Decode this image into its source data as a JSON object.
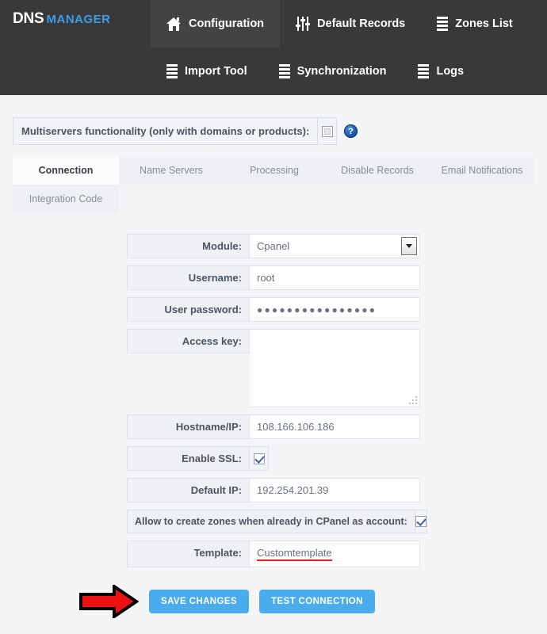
{
  "brand": {
    "primary": "DNS",
    "secondary": "MANAGER"
  },
  "nav": {
    "row1": [
      {
        "label": "Configuration",
        "icon": "home-icon",
        "active": true
      },
      {
        "label": "Default Records",
        "icon": "sliders-icon",
        "active": false
      },
      {
        "label": "Zones List",
        "icon": "server-icon",
        "active": false
      }
    ],
    "row2": [
      {
        "label": "Import Tool",
        "icon": "server-icon",
        "active": false
      },
      {
        "label": "Synchronization",
        "icon": "server-icon",
        "active": false
      },
      {
        "label": "Logs",
        "icon": "server-icon",
        "active": false
      }
    ]
  },
  "multiservers": {
    "label": "Multiservers functionality (only with domains or products):",
    "checked": false,
    "help_icon": "help-icon",
    "help_glyph": "?"
  },
  "tabs": [
    {
      "label": "Connection",
      "active": true
    },
    {
      "label": "Name Servers",
      "active": false
    },
    {
      "label": "Processing",
      "active": false
    },
    {
      "label": "Disable Records",
      "active": false
    },
    {
      "label": "Email Notifications",
      "active": false
    },
    {
      "label": "Integration Code",
      "active": false
    }
  ],
  "form": {
    "module": {
      "label": "Module:",
      "value": "Cpanel"
    },
    "username": {
      "label": "Username:",
      "value": "root"
    },
    "password": {
      "label": "User password:",
      "value": "●●●●●●●●●●●●●●●●"
    },
    "access_key": {
      "label": "Access key:",
      "value": ""
    },
    "hostname": {
      "label": "Hostname/IP:",
      "value": "108.166.106.186"
    },
    "enable_ssl": {
      "label": "Enable SSL:",
      "checked": true
    },
    "default_ip": {
      "label": "Default IP:",
      "value": "192.254.201.39"
    },
    "allow_zones": {
      "label": "Allow to create zones when already in CPanel as account:",
      "checked": true
    },
    "template": {
      "label": "Template:",
      "value": "Customtemplate",
      "misspelled": true
    }
  },
  "actions": {
    "arrow_icon": "red-arrow-annotation",
    "save_label": "SAVE CHANGES",
    "test_label": "TEST CONNECTION"
  },
  "colors": {
    "header_bg": "#393939",
    "header_active": "#434343",
    "brand_blue": "#3d9ee8",
    "button_blue": "#4aacec",
    "page_bg": "#f4f5f7",
    "arrow_red": "#ee1111",
    "spell_red": "#e81c1c"
  }
}
